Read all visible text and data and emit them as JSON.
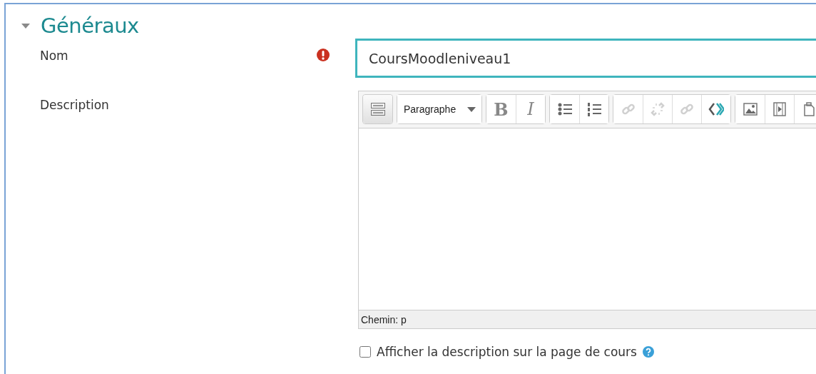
{
  "section": {
    "title": "Généraux",
    "expanded": true
  },
  "fields": [
    {
      "label": "Nom",
      "required": true,
      "value": "CoursMoodleniveau1"
    },
    {
      "label": "Description",
      "required": false
    }
  ],
  "editor": {
    "toolbar": [
      {
        "buttons": [
          {
            "kind": "toggle",
            "disabled": false
          }
        ]
      },
      {
        "buttons": [
          {
            "kind": "select",
            "label": "Paragraphe",
            "disabled": false
          }
        ]
      },
      {
        "buttons": [
          {
            "kind": "bold",
            "label": "B",
            "disabled": false
          },
          {
            "kind": "italic",
            "label": "I",
            "disabled": false
          }
        ]
      },
      {
        "buttons": [
          {
            "kind": "bullets",
            "disabled": false
          },
          {
            "kind": "numbers",
            "disabled": false
          }
        ]
      },
      {
        "buttons": [
          {
            "kind": "link",
            "disabled": true
          },
          {
            "kind": "unlink",
            "disabled": true
          },
          {
            "kind": "anchor",
            "disabled": true
          },
          {
            "kind": "code",
            "disabled": false
          }
        ]
      },
      {
        "buttons": [
          {
            "kind": "image",
            "disabled": false
          },
          {
            "kind": "media",
            "disabled": false
          },
          {
            "kind": "paste",
            "disabled": false
          }
        ]
      }
    ],
    "path": "Chemin: p"
  },
  "option": {
    "label": "Afficher la description sur la page de cours",
    "checked": false,
    "help": true
  }
}
